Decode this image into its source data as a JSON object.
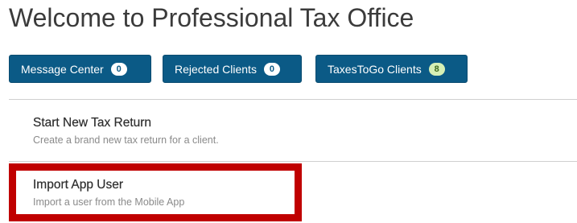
{
  "page_title": "Welcome to Professional Tax Office",
  "buttons": {
    "message_center": {
      "label": "Message Center",
      "count": "0"
    },
    "rejected_clients": {
      "label": "Rejected Clients",
      "count": "0"
    },
    "taxestogo_clients": {
      "label": "TaxesToGo Clients",
      "count": "8"
    }
  },
  "options": {
    "start_new": {
      "title": "Start New Tax Return",
      "description": "Create a brand new tax return for a client."
    },
    "import_app_user": {
      "title": "Import App User",
      "description": "Import a user from the Mobile App"
    }
  },
  "colors": {
    "button_bg": "#0b5a86",
    "highlight": "#c00000",
    "badge_green": "#d6f0b5"
  }
}
